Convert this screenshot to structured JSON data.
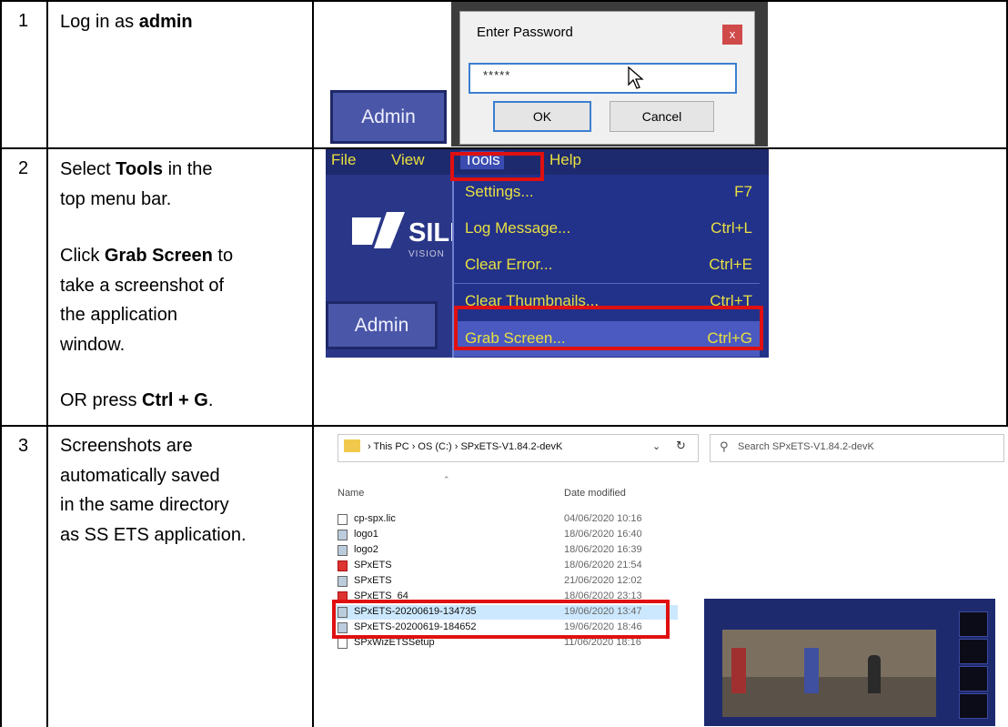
{
  "rows": [
    {
      "number": "1",
      "instruction": {
        "prefix": "Log in as ",
        "bold": "admin"
      }
    },
    {
      "number": "2",
      "instruction": {
        "line1_prefix": "Select ",
        "line1_bold": "Tools",
        "line1_suffix": " in the",
        "line2": "top menu bar.",
        "line3_prefix": "Click ",
        "line3_bold": "Grab Screen",
        "line3_suffix": " to",
        "line4": "take a screenshot of",
        "line5": "the application",
        "line6": "window.",
        "line7_prefix": "OR press ",
        "line7_bold": "Ctrl + G",
        "line7_suffix": "."
      }
    },
    {
      "number": "3",
      "instruction": {
        "line1": "Screenshots are",
        "line2": "automatically saved",
        "line3": "in the same directory",
        "line4": "as SS ETS application."
      }
    }
  ],
  "password_dialog": {
    "title": "Enter Password",
    "close_glyph": "x",
    "masked_value": "*****",
    "ok_label": "OK",
    "cancel_label": "Cancel",
    "admin_button_label": "Admin"
  },
  "app_window": {
    "menu": [
      "File",
      "View",
      "Tools",
      "Help"
    ],
    "logo_text": "SILE",
    "logo_sub": "VISION",
    "admin_button_label": "Admin",
    "tools_menu": [
      {
        "label": "Settings...",
        "shortcut": "F7"
      },
      {
        "label": "Log Message...",
        "shortcut": "Ctrl+L"
      },
      {
        "label": "Clear Error...",
        "shortcut": "Ctrl+E"
      },
      {
        "label": "Clear Thumbnails...",
        "shortcut": "Ctrl+T"
      },
      {
        "label": "Grab Screen...",
        "shortcut": "Ctrl+G"
      }
    ]
  },
  "explorer": {
    "breadcrumb": "›  This PC  ›  OS (C:)  ›  SPxETS-V1.84.2-devK",
    "search_placeholder": "Search SPxETS-V1.84.2-devK",
    "columns": {
      "name": "Name",
      "date": "Date modified"
    },
    "files": [
      {
        "name": "cp-spx.lic",
        "date": "04/06/2020 10:16",
        "icon": "file-icon"
      },
      {
        "name": "logo1",
        "date": "18/06/2020 16:40",
        "icon": "image-icon"
      },
      {
        "name": "logo2",
        "date": "18/06/2020 16:39",
        "icon": "image-icon"
      },
      {
        "name": "SPxETS",
        "date": "18/06/2020 21:54",
        "icon": "app-icon"
      },
      {
        "name": "SPxETS",
        "date": "21/06/2020 12:02",
        "icon": "config-icon"
      },
      {
        "name": "SPxETS_64",
        "date": "18/06/2020 23:13",
        "icon": "app-icon"
      },
      {
        "name": "SPxETS-20200619-134735",
        "date": "19/06/2020 13:47",
        "icon": "image-icon"
      },
      {
        "name": "SPxETS-20200619-184652",
        "date": "19/06/2020 18:46",
        "icon": "image-icon"
      },
      {
        "name": "SPxWizETSSetup",
        "date": "11/06/2020 18:16",
        "icon": "file-icon"
      }
    ]
  },
  "colors": {
    "highlight": "#e01010",
    "app_blue": "#2a3788",
    "menu_yellow": "#e8e040"
  }
}
